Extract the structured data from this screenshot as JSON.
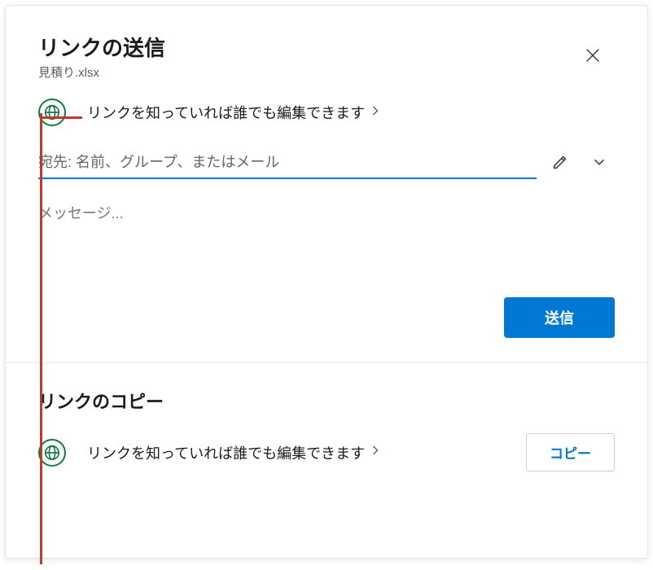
{
  "dialog": {
    "title": "リンクの送信",
    "subtitle": "見積り.xlsx"
  },
  "send_section": {
    "permission_text": "リンクを知っていれば誰でも編集できます",
    "recipient_placeholder": "宛先: 名前、グループ、またはメール",
    "message_placeholder": "メッセージ...",
    "send_label": "送信"
  },
  "copy_section": {
    "title": "リンクのコピー",
    "permission_text": "リンクを知っていれば誰でも編集できます",
    "copy_label": "コピー"
  },
  "colors": {
    "accent_green": "#107c41",
    "accent_blue": "#0078d4",
    "annotation": "#c0392b"
  }
}
